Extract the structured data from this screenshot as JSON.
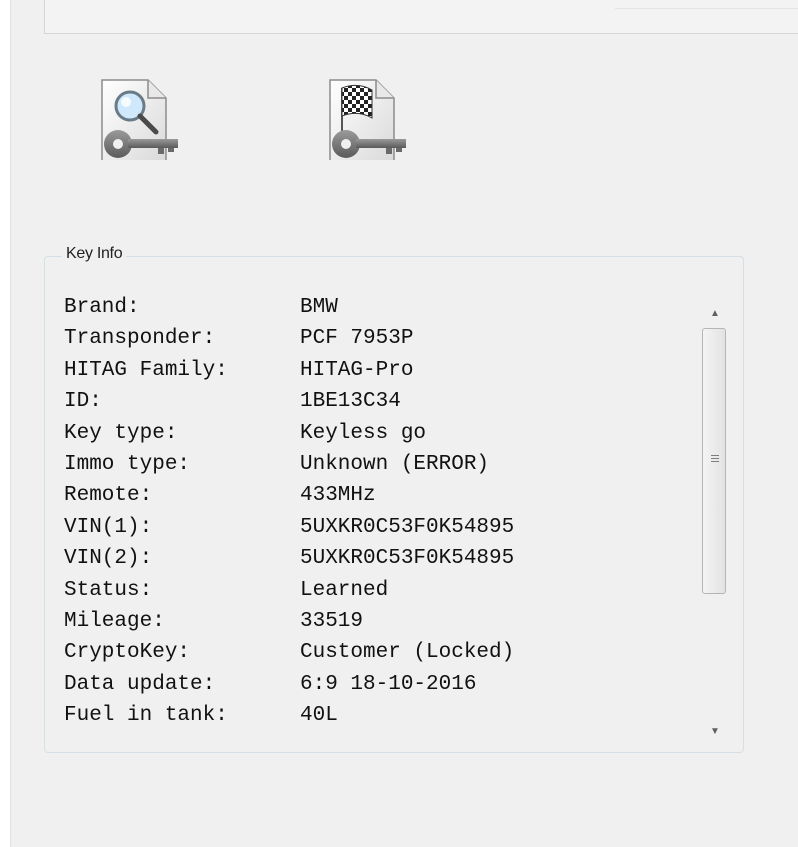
{
  "toolbar": {
    "read_key_icon": "key-document-magnifier-icon",
    "finish_key_icon": "key-document-checkered-flag-icon"
  },
  "key_info": {
    "title": "Key Info",
    "rows": [
      {
        "label": "Brand:",
        "value": "BMW"
      },
      {
        "label": "Transponder:",
        "value": "PCF 7953P"
      },
      {
        "label": "HITAG Family:",
        "value": "HITAG-Pro"
      },
      {
        "label": "ID:",
        "value": "1BE13C34"
      },
      {
        "label": "Key type:",
        "value": "Keyless go"
      },
      {
        "label": "Immo type:",
        "value": "Unknown (ERROR)"
      },
      {
        "label": "Remote:",
        "value": "433MHz"
      },
      {
        "label": "VIN(1):",
        "value": "5UXKR0C53F0K54895"
      },
      {
        "label": "VIN(2):",
        "value": "5UXKR0C53F0K54895"
      },
      {
        "label": "Status:",
        "value": "Learned"
      },
      {
        "label": "Mileage:",
        "value": "33519"
      },
      {
        "label": "CryptoKey:",
        "value": "Customer (Locked)"
      },
      {
        "label": "Data update:",
        "value": "6:9 18-10-2016"
      },
      {
        "label": "Fuel in tank:",
        "value": "40L"
      }
    ]
  },
  "scrollbar": {
    "up_arrow": "▲",
    "down_arrow": "▼"
  }
}
